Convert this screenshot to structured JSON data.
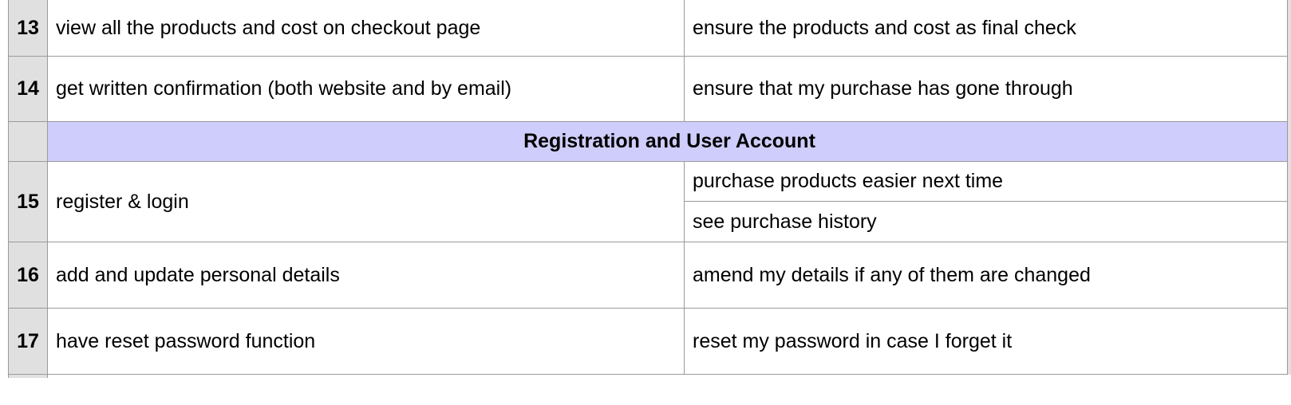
{
  "rows": [
    {
      "num": "13",
      "want": "view all the products and cost on checkout page",
      "reason": "ensure the products and cost as final check"
    },
    {
      "num": "14",
      "want": "get written confirmation (both website and by email)",
      "reason": "ensure that my purchase has gone through"
    }
  ],
  "section": {
    "title": "Registration and User Account"
  },
  "row15": {
    "num": "15",
    "want": "register & login",
    "reason_1": "purchase products easier next time",
    "reason_2": "see purchase history"
  },
  "rows_after": [
    {
      "num": "16",
      "want": "add and update personal details",
      "reason": "amend my details if any of them are changed"
    },
    {
      "num": "17",
      "want": "have reset password function",
      "reason": "reset my password in case I forget it"
    }
  ]
}
